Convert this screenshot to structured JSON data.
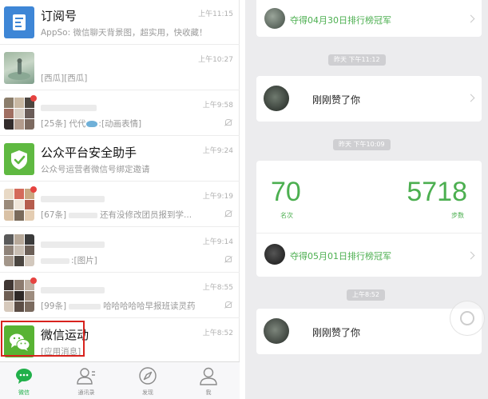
{
  "chat_list": [
    {
      "title": "订阅号",
      "subtitle": "AppSo: 微信聊天背景图，超实用，快收藏！",
      "time": "上午11:15",
      "avatar": "subscription-icon",
      "unread_dot": false,
      "muted": false
    },
    {
      "title": "",
      "subtitle": "[西瓜][西瓜]",
      "time": "上午10:27",
      "avatar": "photo",
      "unread_dot": false,
      "muted": false
    },
    {
      "title": "",
      "subtitle": "[25条] 代代",
      "subtitle_tail": ":[动画表情]",
      "time": "上午9:58",
      "avatar": "group-grid",
      "unread_dot": true,
      "muted": true
    },
    {
      "title": "公众平台安全助手",
      "subtitle": "公众号运营者微信号绑定邀请",
      "time": "上午9:24",
      "avatar": "shield-icon",
      "unread_dot": false,
      "muted": false
    },
    {
      "title": "",
      "subtitle": "[67条]",
      "subtitle_tail": "还有没修改团员报到学...",
      "time": "上午9:19",
      "avatar": "group-grid",
      "unread_dot": true,
      "muted": true
    },
    {
      "title": "",
      "subtitle": "",
      "subtitle_tail": ":[图片]",
      "time": "上午9:14",
      "avatar": "group-grid",
      "unread_dot": false,
      "muted": true
    },
    {
      "title": "",
      "subtitle": "[99条]",
      "subtitle_tail": "哈哈哈哈哈早报班读灵药",
      "time": "上午8:55",
      "avatar": "group-grid",
      "unread_dot": true,
      "muted": true
    },
    {
      "title": "微信运动",
      "subtitle": "[应用消息]",
      "time": "上午8:52",
      "avatar": "wechat-icon",
      "unread_dot": false,
      "muted": false
    }
  ],
  "tabbar": [
    {
      "label": "微信",
      "icon": "chat-icon",
      "active": true
    },
    {
      "label": "通讯录",
      "icon": "contacts-icon",
      "active": false
    },
    {
      "label": "发现",
      "icon": "compass-icon",
      "active": false
    },
    {
      "label": "我",
      "icon": "profile-icon",
      "active": false
    }
  ],
  "sports": {
    "champion_top": "夺得04月30日排行榜冠军",
    "stamp1": "昨天 下午11:12",
    "like1": "刚刚赞了你",
    "stamp2": "昨天 下午10:09",
    "rank_value": "70",
    "rank_label": "名次",
    "steps_value": "5718",
    "steps_label": "步数",
    "champion_card": "夺得05月01日排行榜冠军",
    "stamp3": "上午8:52",
    "like2": "刚刚赞了你"
  },
  "colors": {
    "accent_green": "#4caf50",
    "highlight_red": "#d8231e",
    "tab_active": "#21b04a"
  }
}
